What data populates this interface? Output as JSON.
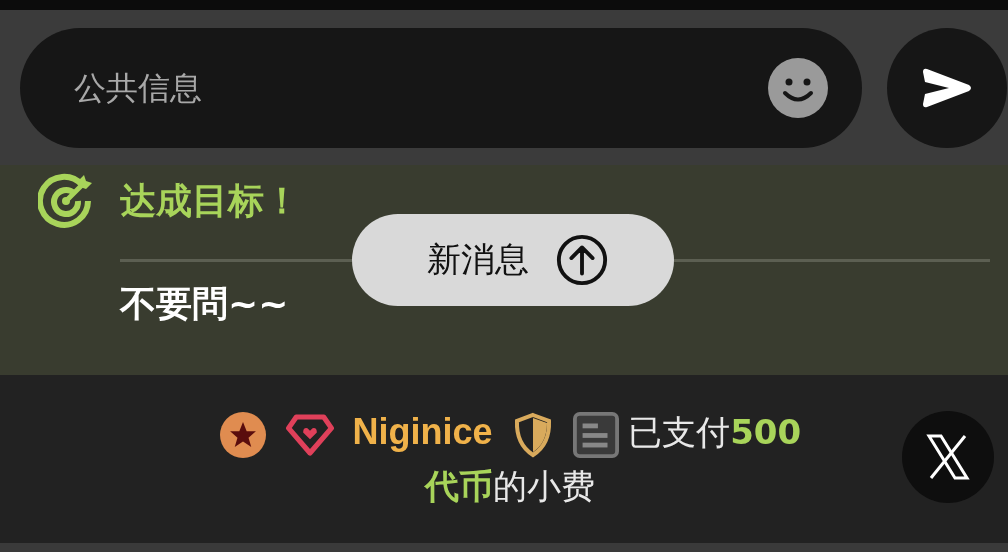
{
  "composer": {
    "placeholder": "公共信息"
  },
  "goal": {
    "title": "达成目标！",
    "message": "不要問~~"
  },
  "new_messages": {
    "label": "新消息"
  },
  "tip_notice": {
    "user": "Niginice",
    "lines": [
      "已支付**500**",
      "**代币**的小费"
    ]
  }
}
